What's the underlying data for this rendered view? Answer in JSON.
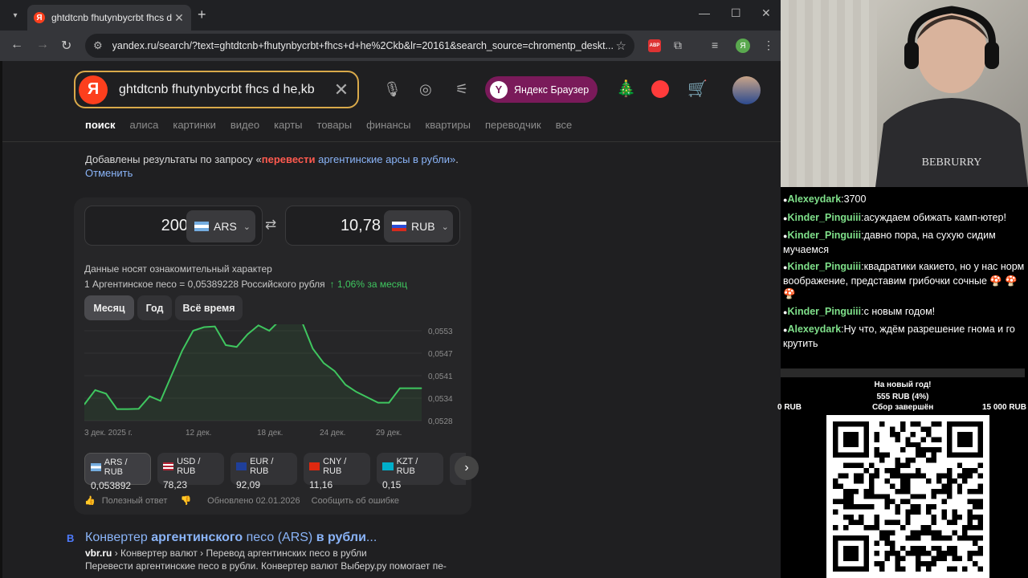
{
  "browser": {
    "tab_title": "ghtdtcnb fhutynbycrbt fhcs d he,kb",
    "url": "yandex.ru/search/?text=ghtdtcnb+fhutynbycrbt+fhcs+d+he%2Ckb&lr=20161&search_source=chromentp_deskt...",
    "abp_label": "ABP",
    "profile_letter": "Я"
  },
  "search": {
    "logo": "Я",
    "query": "ghtdtcnb fhutynbycrbt fhcs d he,kb",
    "ybrowser_label": "Яндекс Браузер",
    "ybrowser_logo": "Y",
    "tabs": [
      "поиск",
      "алиса",
      "картинки",
      "видео",
      "карты",
      "товары",
      "финансы",
      "квартиры",
      "переводчик",
      "все"
    ],
    "notice_prefix": "Добавлены результаты по запросу «",
    "notice_red": "перевести",
    "notice_mid": " аргентинские арсы в рубли»",
    "notice_sep": ". ",
    "notice_cancel": "Отменить"
  },
  "converter": {
    "from_amount": "200",
    "from_currency": "ARS",
    "to_amount": "10,78",
    "to_currency": "RUB",
    "disclaimer": "Данные носят ознакомительный характер",
    "rate_text": "1 Аргентинское песо = 0,05389228 Российского рубля",
    "rate_change": "↑ 1,06%  за месяц",
    "periods": [
      "Месяц",
      "Год",
      "Всё время"
    ],
    "foot_helpful": "Полезный ответ",
    "foot_updated": "Обновлено 02.01.2026",
    "foot_report": "Сообщить об ошибке"
  },
  "pairs": [
    {
      "name": "ARS / RUB",
      "value": "0,053892",
      "flag": "ar"
    },
    {
      "name": "USD / RUB",
      "value": "78,23",
      "flag": "us"
    },
    {
      "name": "EUR / RUB",
      "value": "92,09",
      "flag": "eu"
    },
    {
      "name": "CNY / RUB",
      "value": "11,16",
      "flag": "cn"
    },
    {
      "name": "KZT / RUB",
      "value": "0,15",
      "flag": "kz"
    }
  ],
  "chart_data": {
    "type": "area",
    "x_ticks": [
      "3 дек. 2025 г.",
      "12 дек.",
      "18 дек.",
      "24 дек.",
      "29 дек."
    ],
    "y_ticks": [
      "0,0553",
      "0,0547",
      "0,0541",
      "0,0534",
      "0,0528"
    ],
    "ylim": [
      0.0528,
      0.0553
    ],
    "series": [
      {
        "values": [
          0.05325,
          0.05365,
          0.05355,
          0.05312,
          0.05312,
          0.05313,
          0.05348,
          0.05335,
          0.05405,
          0.05475,
          0.0553,
          0.0554,
          0.05542,
          0.0549,
          0.05485,
          0.0552,
          0.05545,
          0.0553,
          0.0556,
          0.05558,
          0.05555,
          0.0548,
          0.0544,
          0.05418,
          0.0538,
          0.0536,
          0.05345,
          0.0533,
          0.0533,
          0.0537,
          0.0537,
          0.0537
        ]
      }
    ],
    "color": "#3fc65f"
  },
  "result": {
    "badge": "В",
    "title_pre": "Конвертер ",
    "title_bold": "аргентинского",
    "title_mid": " песо (ARS) ",
    "title_bold2": "в рубли",
    "title_end": "...",
    "url_site": "vbr.ru",
    "url_path": " › Конвертер валют › Перевод аргентинских песо в рубли",
    "snippet": "Перевести аргентинские песо в рубли. Конвертер валют Выберу.ру помогает пе-"
  },
  "stream": {
    "chat": [
      {
        "user": "Alexeydark",
        "text": "3700"
      },
      {
        "user": "Kinder_Pinguiii",
        "text": "асуждаем обижать камп-ютер!"
      },
      {
        "user": "Kinder_Pinguiii",
        "text": "давно пора, на сухую сидим мучаемся"
      },
      {
        "user": "Kinder_Pinguiii",
        "text": "квадратики какието, но у нас норм воображение, представим грибочки сочные 🍄 🍄 🍄"
      },
      {
        "user": "Kinder_Pinguiii",
        "text": "с новым годом!"
      },
      {
        "user": "Alexeydark",
        "text": "Ну что, ждём разрешение гнома и го крутить"
      }
    ],
    "goal_title": "На новый год!",
    "goal_amount": "555 RUB (4%)",
    "goal_min": "0 RUB",
    "goal_status": "Сбор завершён",
    "goal_max": "15 000 RUB",
    "shirt_text": "BEBRURRY"
  }
}
